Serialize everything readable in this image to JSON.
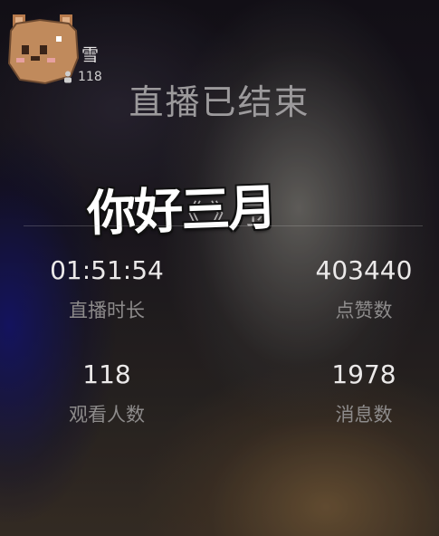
{
  "header": {
    "username": "雪",
    "viewer_count": "118"
  },
  "title": "直播已结束",
  "book_title": "《         》序",
  "overlay_sticker_text": "你好三月",
  "stats": [
    {
      "value": "01:51:54",
      "label": "直播时长"
    },
    {
      "value": "403440",
      "label": "点赞数"
    },
    {
      "value": "118",
      "label": "观看人数"
    },
    {
      "value": "1978",
      "label": "消息数"
    }
  ],
  "colors": {
    "bear_fur": "#c08a5c",
    "bear_cheek": "#e6a0a0",
    "text_primary": "#ebe9e9",
    "text_secondary": "#8d8b8b"
  }
}
